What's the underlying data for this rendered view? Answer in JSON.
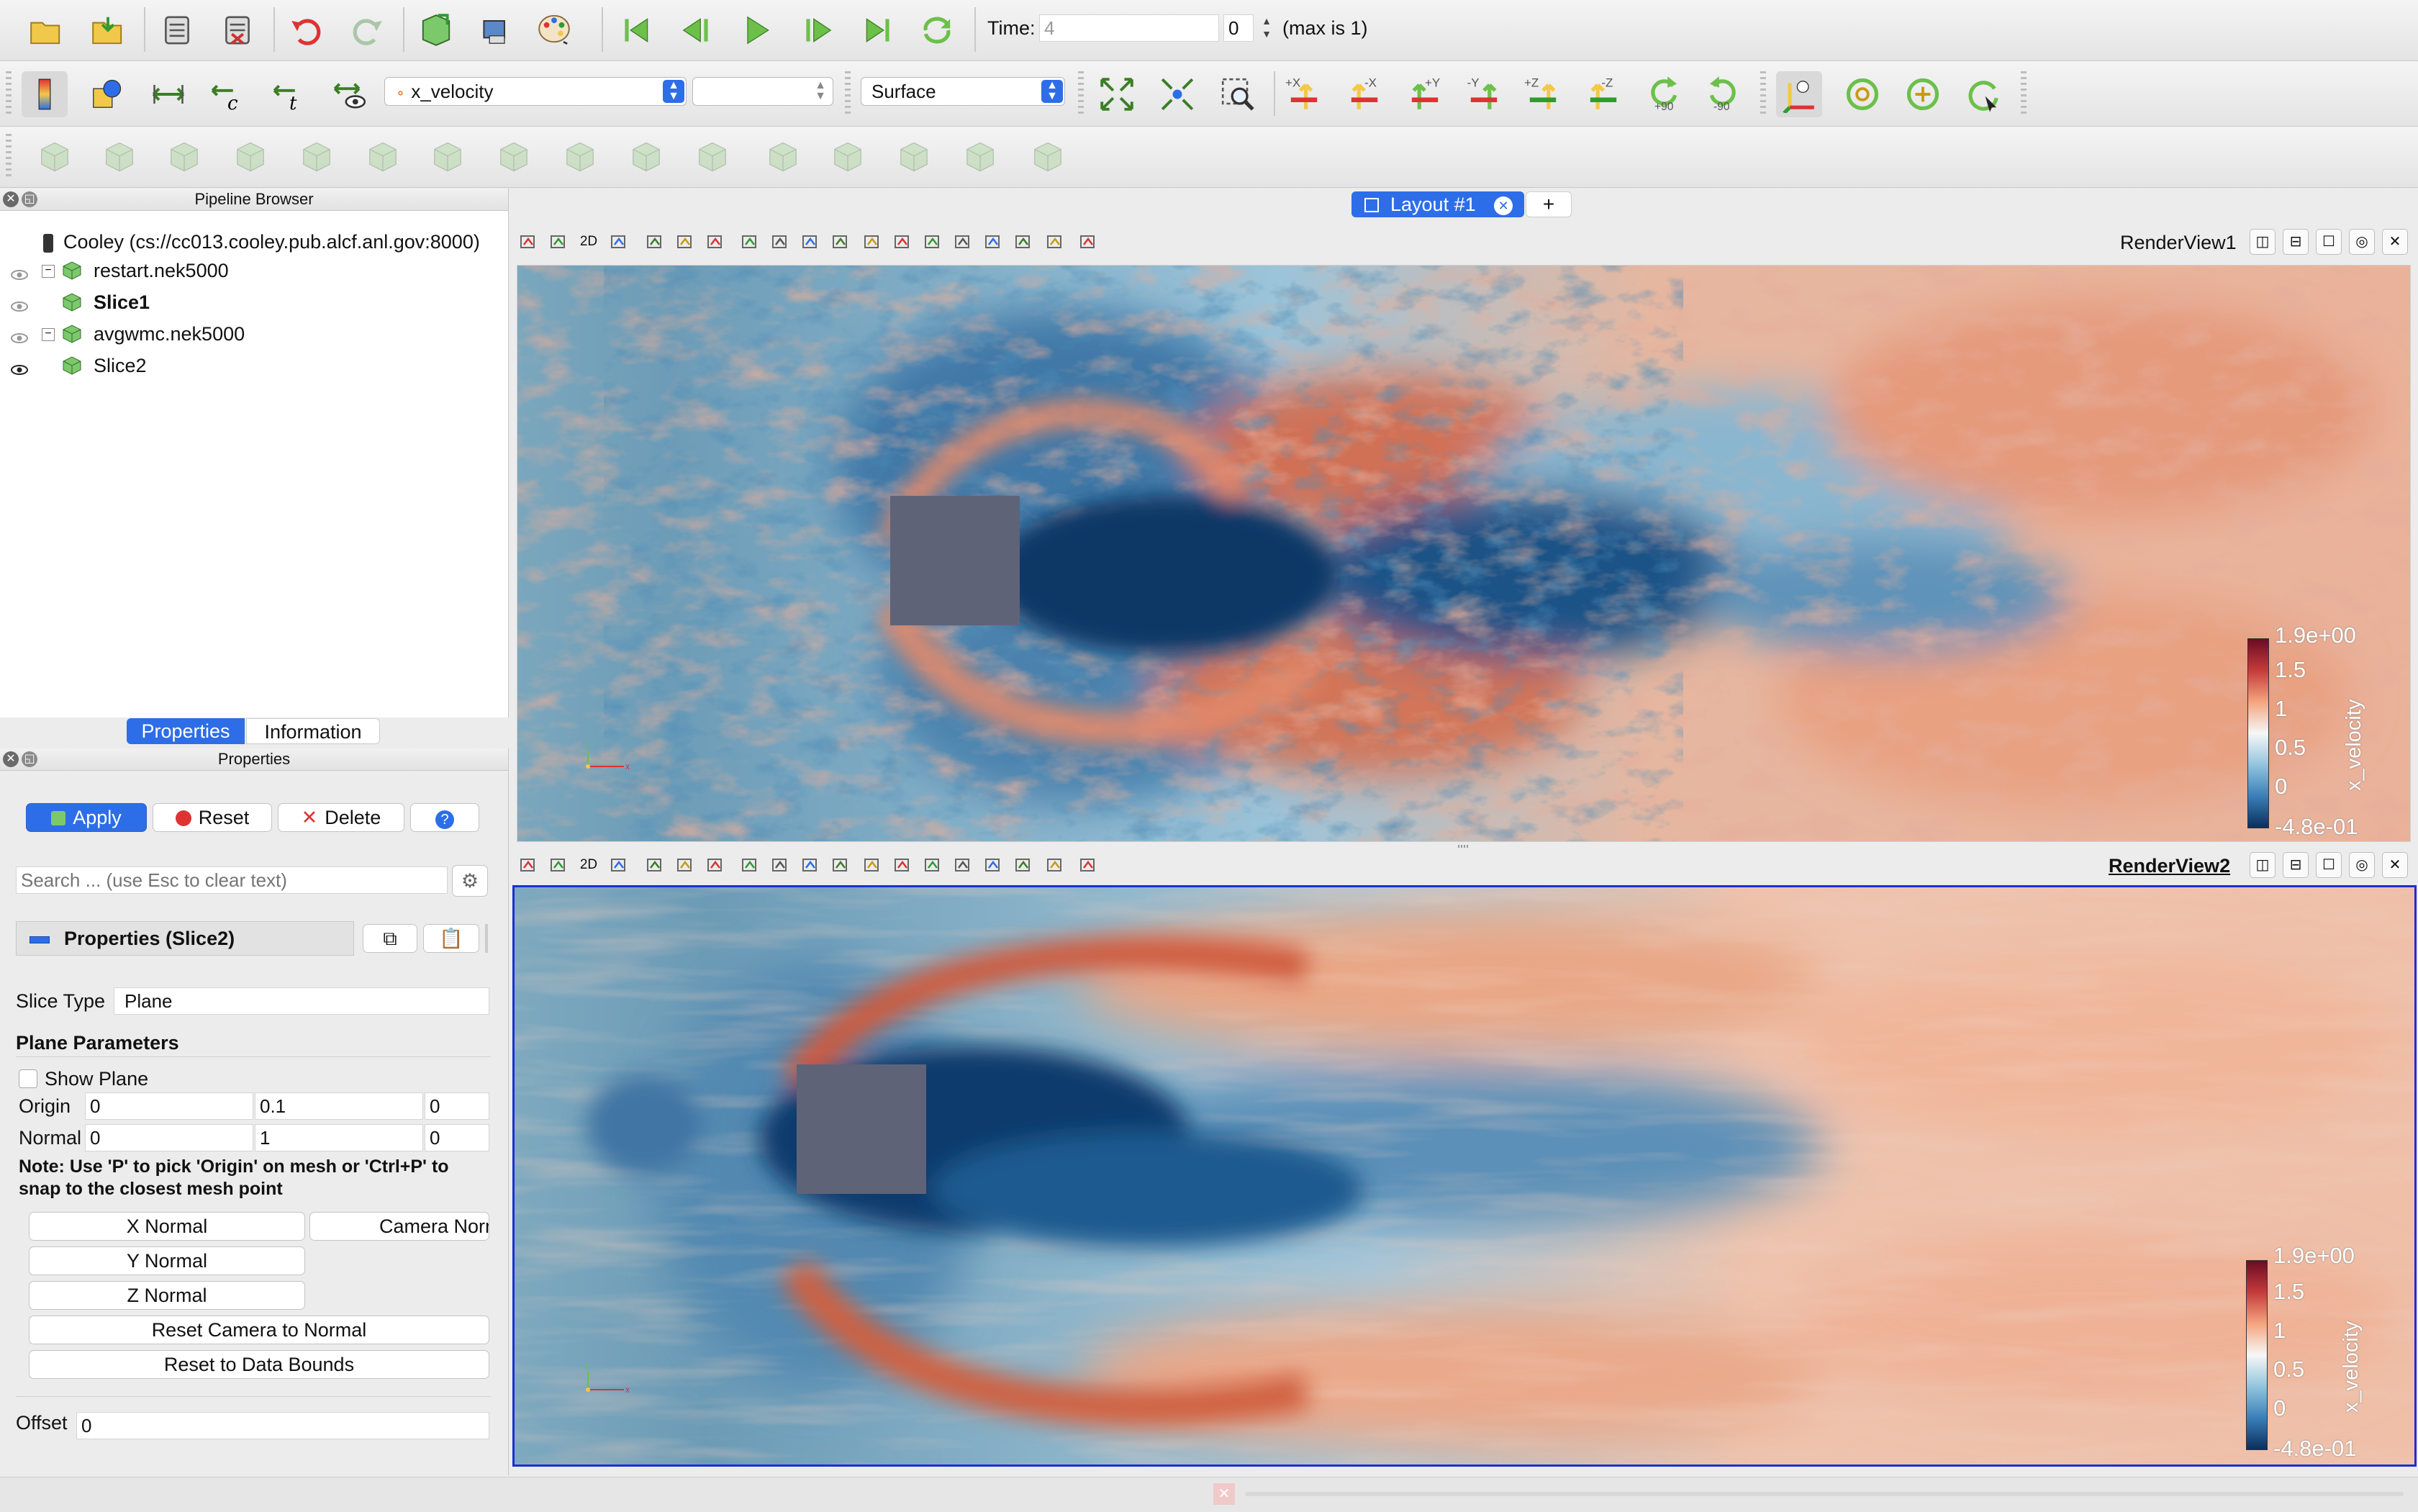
{
  "toolbar": {
    "time_label": "Time:",
    "time_value": "4",
    "timestep_value": "0",
    "max_label": "(max is 1)",
    "color_variable": "x_velocity",
    "component": "",
    "representation": "Surface",
    "camera_labels": [
      "+X",
      "-X",
      "+Y",
      "-Y",
      "+Z",
      "-Z",
      "+90",
      "-90"
    ]
  },
  "pipeline": {
    "title": "Pipeline Browser",
    "items": [
      {
        "label": "Cooley (cs://cc013.cooley.pub.alcf.anl.gov:8000)"
      },
      {
        "label": "restart.nek5000"
      },
      {
        "label": "Slice1"
      },
      {
        "label": "avgwmc.nek5000"
      },
      {
        "label": "Slice2"
      }
    ]
  },
  "tabs": {
    "properties": "Properties",
    "information": "Information"
  },
  "properties": {
    "title": "Properties",
    "apply": "Apply",
    "reset": "Reset",
    "delete": "Delete",
    "help": "?",
    "search_placeholder": "Search ... (use Esc to clear text)",
    "section_header": "Properties (Slice2)",
    "slice_type_label": "Slice Type",
    "slice_type_value": "Plane",
    "plane_params": "Plane Parameters",
    "show_plane": "Show Plane",
    "origin_label": "Origin",
    "origin": [
      "0",
      "0.1",
      "0"
    ],
    "normal_label": "Normal",
    "normal": [
      "0",
      "1",
      "0"
    ],
    "note": "Note: Use 'P' to pick 'Origin' on mesh or 'Ctrl+P' to snap to the closest mesh point",
    "x_normal": "X Normal",
    "camera_normal": "Camera Normal",
    "y_normal": "Y Normal",
    "z_normal": "Z Normal",
    "reset_camera": "Reset Camera to Normal",
    "reset_bounds": "Reset to Data Bounds",
    "offset_label": "Offset",
    "offset_value": "0"
  },
  "layout": {
    "tab_label": "Layout #1",
    "add": "+"
  },
  "views": {
    "view1": {
      "name": "RenderView1",
      "twod": "2D"
    },
    "view2": {
      "name": "RenderView2",
      "twod": "2D"
    }
  },
  "colorbar": {
    "title": "x_velocity",
    "labels": [
      "1.9e+00",
      "1.5",
      "1",
      "0.5",
      "0",
      "-4.8e-01"
    ],
    "colors": [
      "#6b0c22",
      "#c43b3b",
      "#f4a57f",
      "#f7f7f7",
      "#92c5de",
      "#3a7fb8",
      "#0a2e5c"
    ]
  },
  "colors": {
    "accent": "#2d6ee8",
    "object": "#5f6378"
  }
}
